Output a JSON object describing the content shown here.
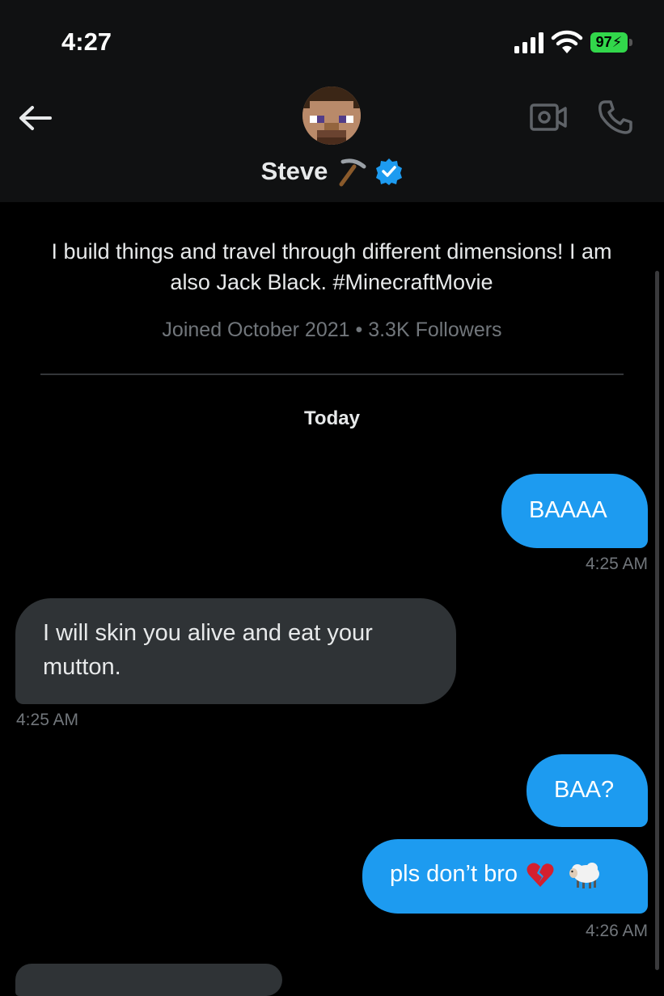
{
  "status_bar": {
    "time": "4:27",
    "battery": "97"
  },
  "header": {
    "contact_name": "Steve",
    "icons": [
      "back-arrow-icon",
      "avatar",
      "pickaxe-icon",
      "verified-badge-icon",
      "video-call-icon",
      "phone-icon"
    ],
    "colors": {
      "verified": "#1d9bf0",
      "header_bg": "#101112"
    }
  },
  "profile": {
    "bio": "I build things and travel through different dimensions! I am also Jack Black. #MinecraftMovie",
    "joined": "Joined October 2021",
    "separator": "•",
    "followers": "3.3K Followers"
  },
  "conversation": {
    "day_label": "Today",
    "messages": [
      {
        "direction": "outgoing",
        "text": "BAAAA",
        "time": "4:25 AM"
      },
      {
        "direction": "incoming",
        "text": "I will skin you alive and eat your mutton.",
        "time": "4:25 AM"
      },
      {
        "direction": "outgoing",
        "text": "BAA?",
        "time": ""
      },
      {
        "direction": "outgoing",
        "text": "pls don’t bro",
        "emoji": [
          "broken-heart",
          "sheep"
        ],
        "time": "4:26 AM"
      }
    ],
    "colors": {
      "outgoing_bubble": "#1d9bf0",
      "incoming_bubble": "#2f3336",
      "timestamp": "#71767b"
    }
  }
}
